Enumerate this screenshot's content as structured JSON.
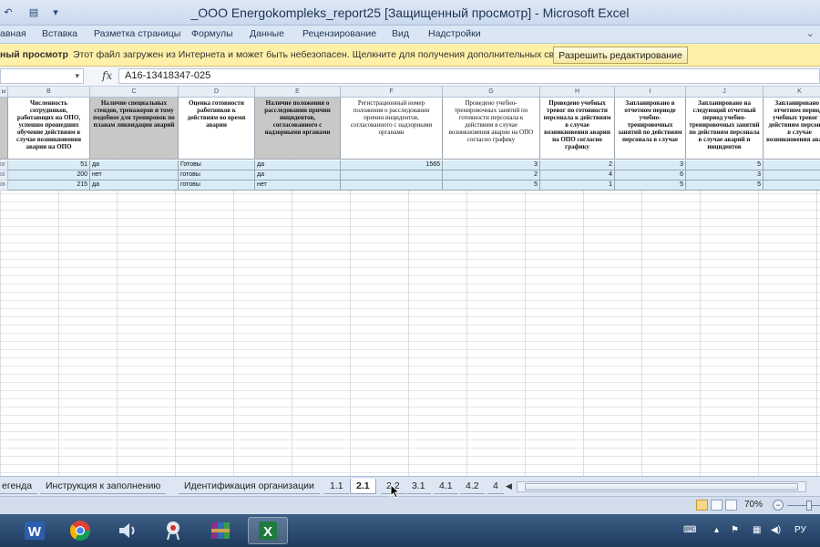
{
  "window": {
    "title": "_OOO Energokompleks_report25  [Защищенный просмотр]  -  Microsoft Excel"
  },
  "ribbon": {
    "tabs": [
      "авная",
      "Вставка",
      "Разметка страницы",
      "Формулы",
      "Данные",
      "Рецензирование",
      "Вид",
      "Надстройки"
    ]
  },
  "protected_view": {
    "title": "ный просмотр",
    "message": "Этот файл загружен из Интернета и может быть небезопасен. Щелкните для получения дополнительных сведений.",
    "enable_button": "Разрешить редактирование"
  },
  "formula_bar": {
    "fx": "fx",
    "content": "A16-13418347-025"
  },
  "columns": [
    "ы",
    "B",
    "C",
    "D",
    "E",
    "F",
    "G",
    "H",
    "I",
    "J",
    "K"
  ],
  "headers": [
    "",
    "Численность сотрудников, работающих на ОПО, успешно прошедших обучение действиям в случае возникновения аварии на ОПО",
    "Наличие специальных стендов, тренажеров и тому подобное для тренировок по планам ликвидации аварий",
    "Оценка готовности работников к действиям во время аварии",
    "Наличие положения о расследовании причин инцидентов, согласованного с надзорными органами",
    "Регистрационный номер положения о расследовании причин инцидентов, согласованного с надзорными органами",
    "Проведено учебно-тренировочных занятий по готовности персонала к действиям в случае возникновения аварии на ОПО согласно графику",
    "Проведено учебных тревог по готовности персонала к действиям в случае возникновения аварии на ОПО согласно графику",
    "Запланировано в отчетном периоде учебно-тренировочных занятий по действиям персонала в случае",
    "Запланировано на следующий отчетный период учебно-тренировочных занятий по действиям персонала в случае аварий и инцидентов",
    "Запланировано в отчетном периоде учебных тревог по действиям персонала в случае возникновения аварий"
  ],
  "rows": [
    {
      "rh": "02",
      "cells": [
        "51",
        "да",
        "Готовы",
        "да",
        "1565",
        "3",
        "2",
        "3",
        "5",
        ""
      ]
    },
    {
      "rh": "02",
      "cells": [
        "200",
        "нет",
        "готовы",
        "да",
        "",
        "2",
        "4",
        "6",
        "3",
        ""
      ]
    },
    {
      "rh": "09",
      "cells": [
        "215",
        "да",
        "готовы",
        "нет",
        "",
        "5",
        "1",
        "5",
        "5",
        ""
      ]
    }
  ],
  "sheet_tabs": {
    "items": [
      "егенда",
      "Инструкция к заполнению",
      "Идентификация организации",
      "1.1",
      "2.1",
      "2.2",
      "3.1",
      "4.1",
      "4.2",
      "4"
    ],
    "active": "2.1"
  },
  "status": {
    "zoom": "70%",
    "zoom_minus": "−"
  },
  "taskbar": {
    "apps": [
      "word-icon",
      "chrome-icon",
      "media-player-icon",
      "snipping-tool-icon",
      "winrar-icon",
      "excel-icon"
    ],
    "lang": "РУ"
  }
}
